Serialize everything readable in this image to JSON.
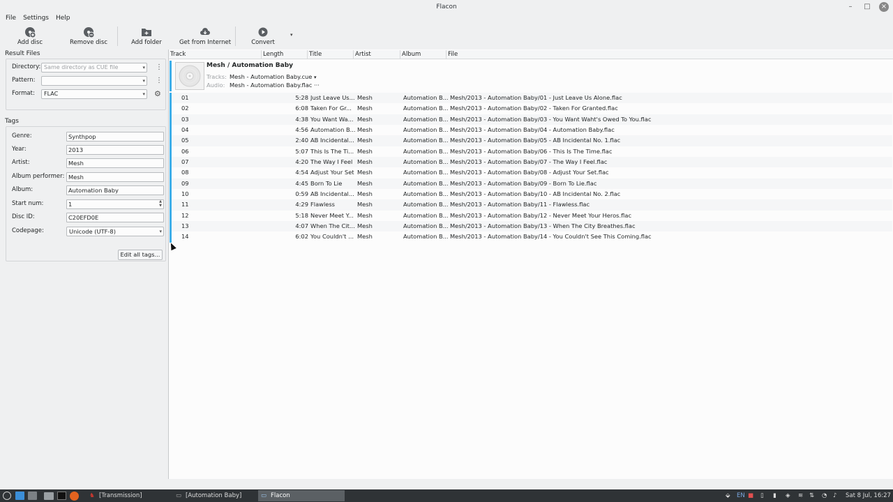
{
  "window": {
    "title": "Flacon"
  },
  "menu": [
    "File",
    "Settings",
    "Help"
  ],
  "toolbar": {
    "add_disc": "Add disc",
    "remove_disc": "Remove disc",
    "add_folder": "Add folder",
    "get_from_internet": "Get from Internet",
    "convert": "Convert"
  },
  "result_files": {
    "title": "Result Files",
    "directory_label": "Directory:",
    "directory_placeholder": "Same directory as CUE file",
    "pattern_label": "Pattern:",
    "pattern_value": "",
    "format_label": "Format:",
    "format_value": "FLAC"
  },
  "tags": {
    "title": "Tags",
    "fields": [
      {
        "label": "Genre:",
        "value": "Synthpop"
      },
      {
        "label": "Year:",
        "value": "2013"
      },
      {
        "label": "Artist:",
        "value": "Mesh"
      },
      {
        "label": "Album performer:",
        "value": "Mesh"
      },
      {
        "label": "Album:",
        "value": "Automation Baby"
      },
      {
        "label": "Start num:",
        "value": "1"
      },
      {
        "label": "Disc ID:",
        "value": "C20EFD0E"
      },
      {
        "label": "Codepage:",
        "value": "Unicode (UTF-8)"
      }
    ],
    "edit_all": "Edit all tags..."
  },
  "table": {
    "columns": [
      "Track",
      "Length",
      "Title",
      "Artist",
      "Album",
      "File"
    ],
    "disc": {
      "title": "Mesh / Automation Baby",
      "tracks_label": "Tracks:",
      "tracks_value": "Mesh - Automation Baby.cue",
      "audio_label": "Audio:",
      "audio_value": "Mesh - Automation Baby.flac"
    },
    "rows": [
      {
        "track": "01",
        "length": "5:28",
        "title": "Just Leave Us...",
        "artist": "Mesh",
        "album": "Automation B...",
        "file": "Mesh/2013 - Automation Baby/01 - Just Leave Us Alone.flac"
      },
      {
        "track": "02",
        "length": "6:08",
        "title": "Taken For Gr...",
        "artist": "Mesh",
        "album": "Automation B...",
        "file": "Mesh/2013 - Automation Baby/02 - Taken For Granted.flac"
      },
      {
        "track": "03",
        "length": "4:38",
        "title": "You Want Wa...",
        "artist": "Mesh",
        "album": "Automation B...",
        "file": "Mesh/2013 - Automation Baby/03 - You Want Waht's Owed To You.flac"
      },
      {
        "track": "04",
        "length": "4:56",
        "title": "Automation B...",
        "artist": "Mesh",
        "album": "Automation B...",
        "file": "Mesh/2013 - Automation Baby/04 - Automation Baby.flac"
      },
      {
        "track": "05",
        "length": "2:40",
        "title": "AB Incidental...",
        "artist": "Mesh",
        "album": "Automation B...",
        "file": "Mesh/2013 - Automation Baby/05 - AB Incidental No. 1.flac"
      },
      {
        "track": "06",
        "length": "5:07",
        "title": "This Is The Ti...",
        "artist": "Mesh",
        "album": "Automation B...",
        "file": "Mesh/2013 - Automation Baby/06 - This Is The Time.flac"
      },
      {
        "track": "07",
        "length": "4:20",
        "title": "The Way I Feel",
        "artist": "Mesh",
        "album": "Automation B...",
        "file": "Mesh/2013 - Automation Baby/07 - The Way I Feel.flac"
      },
      {
        "track": "08",
        "length": "4:54",
        "title": "Adjust Your Set",
        "artist": "Mesh",
        "album": "Automation B...",
        "file": "Mesh/2013 - Automation Baby/08 - Adjust Your Set.flac"
      },
      {
        "track": "09",
        "length": "4:45",
        "title": "Born To Lie",
        "artist": "Mesh",
        "album": "Automation B...",
        "file": "Mesh/2013 - Automation Baby/09 - Born To Lie.flac"
      },
      {
        "track": "10",
        "length": "0:59",
        "title": "AB Incidental...",
        "artist": "Mesh",
        "album": "Automation B...",
        "file": "Mesh/2013 - Automation Baby/10 - AB Incidental No. 2.flac"
      },
      {
        "track": "11",
        "length": "4:29",
        "title": "Flawless",
        "artist": "Mesh",
        "album": "Automation B...",
        "file": "Mesh/2013 - Automation Baby/11 - Flawless.flac"
      },
      {
        "track": "12",
        "length": "5:18",
        "title": "Never Meet Y...",
        "artist": "Mesh",
        "album": "Automation B...",
        "file": "Mesh/2013 - Automation Baby/12 - Never Meet Your Heros.flac"
      },
      {
        "track": "13",
        "length": "4:07",
        "title": "When The Cit...",
        "artist": "Mesh",
        "album": "Automation B...",
        "file": "Mesh/2013 - Automation Baby/13 - When The City Breathes.flac"
      },
      {
        "track": "14",
        "length": "6:02",
        "title": "You Couldn't ...",
        "artist": "Mesh",
        "album": "Automation B...",
        "file": "Mesh/2013 - Automation Baby/14 - You Couldn't See This Coming.flac"
      }
    ]
  },
  "taskbar": {
    "tasks": [
      {
        "label": "[Transmission]"
      },
      {
        "label": "[Automation Baby]"
      },
      {
        "label": "Flacon"
      }
    ],
    "lang": "EN",
    "clock": "Sat 8 Jul, 16:27"
  },
  "colors": {
    "accent": "#3daee9",
    "taskbar": "#2f3336"
  },
  "icons": [
    "add-disc-icon",
    "remove-disc-icon",
    "add-folder-icon",
    "cloud-download-icon",
    "play-circle-icon",
    "gear-icon",
    "kebab-icon"
  ]
}
